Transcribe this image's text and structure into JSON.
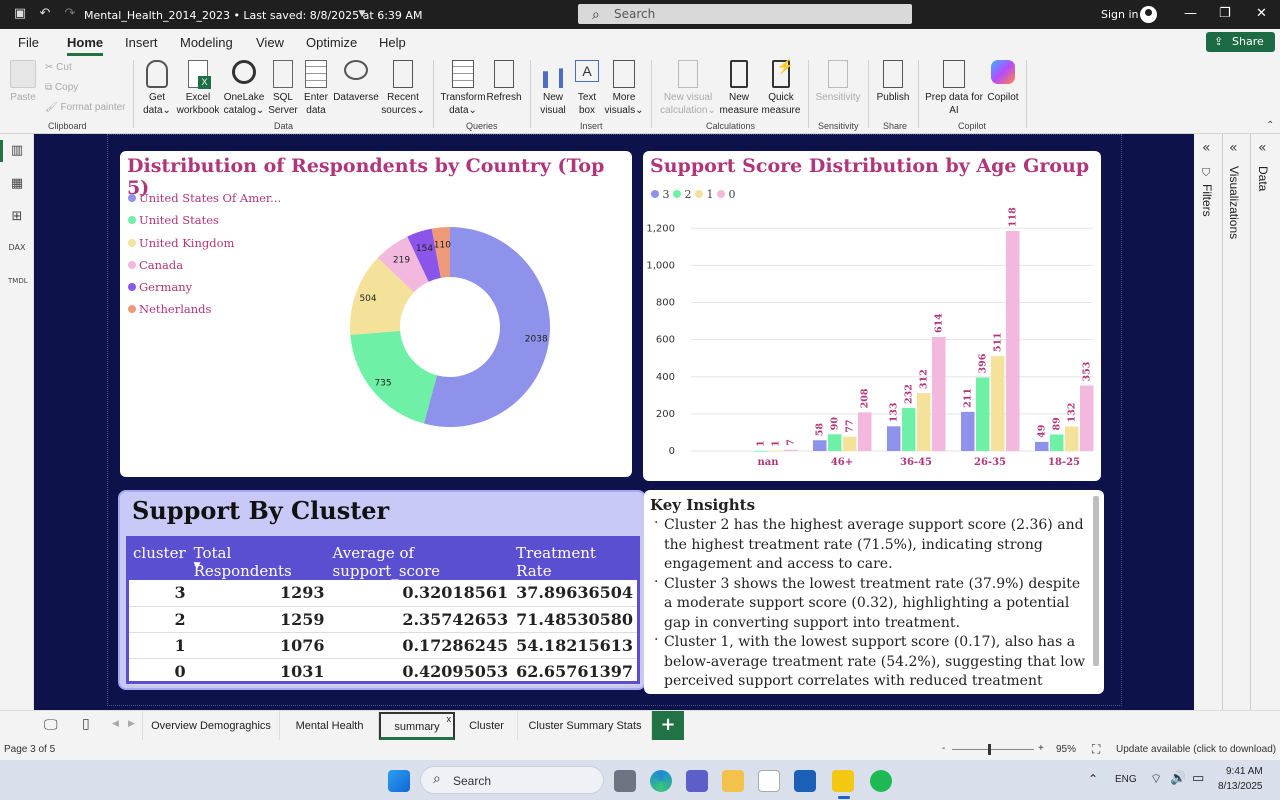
{
  "window": {
    "doc_title": "Mental_Health_2014_2023 • Last saved: 8/8/2025 at 6:39 AM",
    "search_placeholder": "Search",
    "sign_in": "Sign in"
  },
  "menu": {
    "items": [
      "File",
      "Home",
      "Insert",
      "Modeling",
      "View",
      "Optimize",
      "Help"
    ],
    "share": "Share"
  },
  "ribbon": {
    "clipboard": {
      "paste": "Paste",
      "cut": "Cut",
      "copy": "Copy",
      "format_painter": "Format painter",
      "group": "Clipboard"
    },
    "data": {
      "get_data": [
        "Get",
        "data"
      ],
      "excel": [
        "Excel",
        "workbook"
      ],
      "onelake": [
        "OneLake",
        "catalog"
      ],
      "sql": [
        "SQL",
        "Server"
      ],
      "enter": [
        "Enter",
        "data"
      ],
      "dataverse": [
        "Dataverse"
      ],
      "recent": [
        "Recent",
        "sources"
      ],
      "group": "Data"
    },
    "queries": {
      "transform": [
        "Transform",
        "data"
      ],
      "refresh": [
        "Refresh"
      ],
      "group": "Queries"
    },
    "insert": {
      "new_visual": [
        "New",
        "visual"
      ],
      "text_box": [
        "Text",
        "box"
      ],
      "more_visuals": [
        "More",
        "visuals"
      ],
      "group": "Insert"
    },
    "calculations": {
      "new_visual_calc": [
        "New visual",
        "calculation"
      ],
      "new_measure": [
        "New",
        "measure"
      ],
      "quick_measure": [
        "Quick",
        "measure"
      ],
      "group": "Calculations"
    },
    "sensitivity": {
      "label": [
        "Sensitivity"
      ],
      "group": "Sensitivity"
    },
    "share": {
      "publish": [
        "Publish"
      ],
      "group": "Share"
    },
    "copilot": {
      "prep": [
        "Prep data for",
        "AI"
      ],
      "copilot": [
        "Copilot"
      ],
      "group": "Copilot"
    }
  },
  "panes": {
    "filters": "Filters",
    "visualizations": "Visualizations",
    "data": "Data"
  },
  "donut": {
    "title": "Distribution of Respondents by Country (Top 5)",
    "legend": [
      "United States Of Amer...",
      "United States",
      "United Kingdom",
      "Canada",
      "Germany",
      "Netherlands"
    ],
    "colors": {
      "United States Of Amer...": "#8f92ea",
      "United States": "#6ef0a6",
      "United Kingdom": "#f4e29a",
      "Canada": "#f2b8dd",
      "Germany": "#8a55e8",
      "Netherlands": "#ee9a78"
    }
  },
  "bars": {
    "title": "Support Score Distribution by Age Group",
    "legend": [
      "3",
      "2",
      "1",
      "0"
    ],
    "colors": {
      "3": "#8f92ea",
      "2": "#6ef0a6",
      "1": "#f4e29a",
      "0": "#f2b8dd"
    }
  },
  "chart_data": [
    {
      "type": "pie",
      "title": "Distribution of Respondents by Country (Top 5)",
      "categories": [
        "United States Of Amer...",
        "United States",
        "United Kingdom",
        "Canada",
        "Germany",
        "Netherlands"
      ],
      "values": [
        2038,
        735,
        504,
        219,
        154,
        110
      ],
      "legend_position": "left"
    },
    {
      "type": "bar",
      "title": "Support Score Distribution by Age Group",
      "categories": [
        "nan",
        "46+",
        "36-45",
        "26-35",
        "18-25"
      ],
      "series": [
        {
          "name": "3",
          "values": [
            null,
            58,
            133,
            211,
            49
          ]
        },
        {
          "name": "2",
          "values": [
            1,
            90,
            232,
            396,
            89
          ]
        },
        {
          "name": "1",
          "values": [
            1,
            77,
            312,
            511,
            132
          ]
        },
        {
          "name": "0",
          "values": [
            7,
            208,
            614,
            1185,
            353
          ]
        }
      ],
      "ylim": [
        0,
        1250
      ],
      "yticks": [
        "0",
        "200",
        "400",
        "600",
        "800",
        "1,000",
        "1,200"
      ],
      "grid": true,
      "legend_position": "top-left"
    }
  ],
  "table": {
    "title": "Support By Cluster",
    "headers": [
      "cluster",
      "Total Respondents",
      "Average of support_score",
      "Treatment Rate"
    ],
    "rows": [
      [
        "3",
        "1293",
        "0.32018561",
        "37.89636504"
      ],
      [
        "2",
        "1259",
        "2.35742653",
        "71.48530580"
      ],
      [
        "1",
        "1076",
        "0.17286245",
        "54.18215613"
      ],
      [
        "0",
        "1031",
        "0.42095053",
        "62.65761397"
      ]
    ]
  },
  "insights": {
    "title": "Key Insights",
    "bullets": [
      "Cluster 2 has the highest average support score (2.36) and the highest treatment rate (71.5%), indicating strong engagement and access to care.",
      "Cluster 3 shows the lowest treatment rate (37.9%) despite a moderate support score (0.32), highlighting a potential gap in converting support into treatment.",
      " Cluster 1, with the lowest support score (0.17), also has a below-average treatment rate (54.2%), suggesting that low perceived support correlates with reduced treatment"
    ]
  },
  "pages": {
    "tabs": [
      "Overview Demograghics",
      "Mental Health",
      "summary",
      "Cluster",
      "Cluster Summary Stats"
    ],
    "active": "summary",
    "add": "+"
  },
  "status": {
    "page": "Page 3 of 5",
    "zoom": "95%",
    "update": "Update available (click to download)"
  },
  "taskbar": {
    "search": "Search",
    "lang": "ENG",
    "time": "9:41 AM",
    "date": "8/13/2025"
  }
}
